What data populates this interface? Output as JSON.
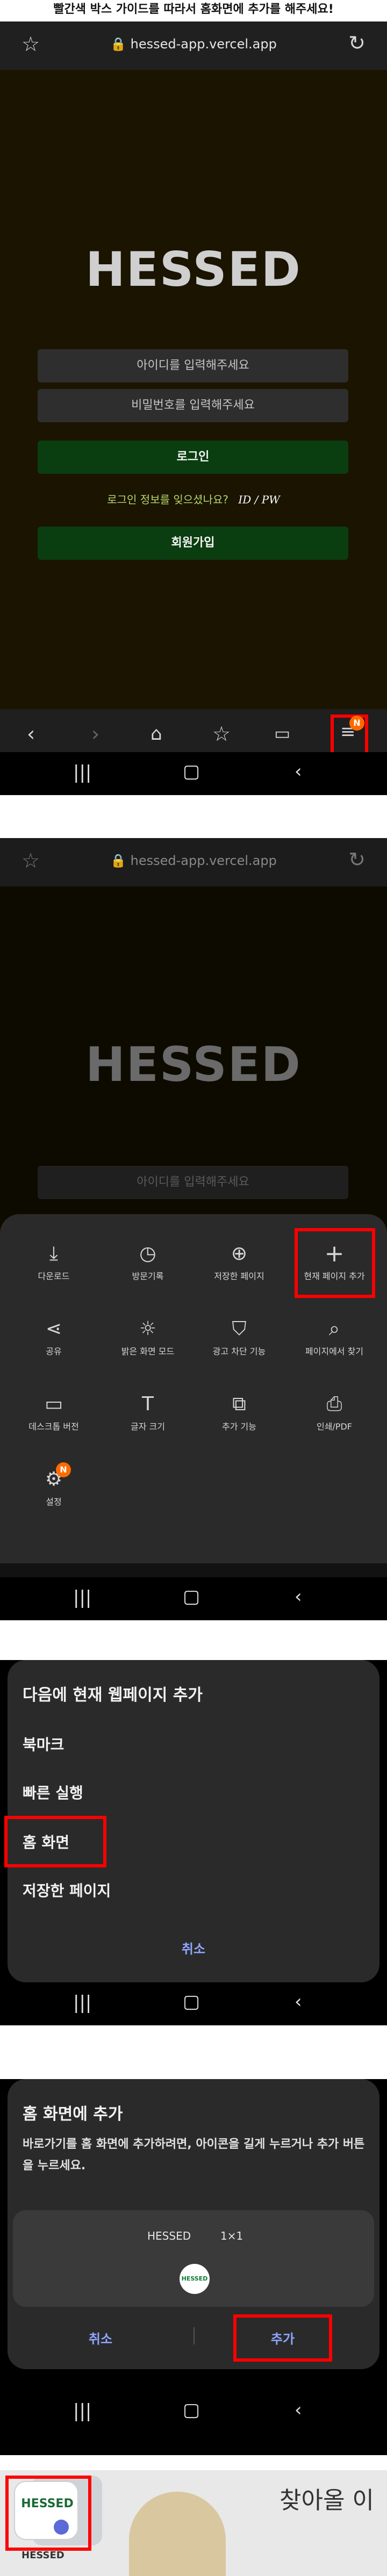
{
  "instruction": "빨간색 박스 가이드를 따라서 홈화면에 추가를 해주세요!",
  "browser": {
    "url": "hessed-app.vercel.app"
  },
  "login": {
    "logo": "HESSED",
    "id_placeholder": "아이디를 입력해주세요",
    "pw_placeholder": "비밀번호를 입력해주세요",
    "login_button": "로그인",
    "forgot_text": "로그인 정보를 잊으셨나요?",
    "forgot_link": "ID / PW",
    "signup_button": "회원가입"
  },
  "badge": "N",
  "menu": {
    "row1": [
      "다운로드",
      "방문기록",
      "저장한 페이지",
      "현재 페이지 추가"
    ],
    "row2": [
      "공유",
      "밝은 화면 모드",
      "광고 차단 기능",
      "페이지에서 찾기"
    ],
    "row3": [
      "데스크톱 버전",
      "글자 크기",
      "추가 기능",
      "인쇄/PDF"
    ],
    "row4": [
      "설정"
    ]
  },
  "add_dialog": {
    "title": "다음에 현재 웹페이지 추가",
    "options": [
      "북마크",
      "빠른 실행",
      "홈 화면",
      "저장한 페이지"
    ],
    "cancel": "취소"
  },
  "home_dialog": {
    "title": "홈 화면에 추가",
    "desc": "바로가기를 홈 화면에 추가하려면, 아이콘을 길게 누르거나 추가 버튼을 누르세요.",
    "app_name": "HESSED",
    "size": "1×1",
    "icon_text": "HESSED",
    "cancel": "취소",
    "add": "추가"
  },
  "home_icon": {
    "label": "HESSED"
  },
  "comic": {
    "text": "찾아올 이"
  }
}
